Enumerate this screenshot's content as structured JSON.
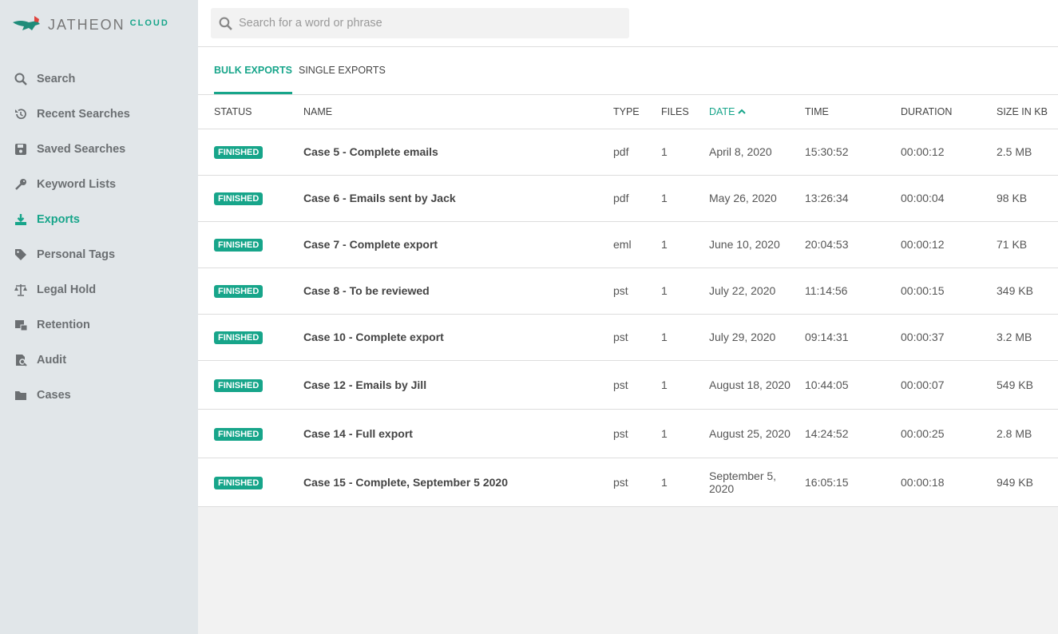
{
  "brand": {
    "name": "JATHEON",
    "suffix": "CLOUD",
    "colors": {
      "accent": "#17a58a",
      "sidebar": "#e1e6e9"
    }
  },
  "sidebar": {
    "items": [
      {
        "label": "Search",
        "icon": "search-icon"
      },
      {
        "label": "Recent Searches",
        "icon": "history-icon"
      },
      {
        "label": "Saved Searches",
        "icon": "save-icon"
      },
      {
        "label": "Keyword Lists",
        "icon": "key-icon"
      },
      {
        "label": "Exports",
        "icon": "download-icon",
        "active": true
      },
      {
        "label": "Personal Tags",
        "icon": "tag-icon"
      },
      {
        "label": "Legal Hold",
        "icon": "scale-icon"
      },
      {
        "label": "Retention",
        "icon": "retention-icon"
      },
      {
        "label": "Audit",
        "icon": "audit-icon"
      },
      {
        "label": "Cases",
        "icon": "folder-icon"
      }
    ]
  },
  "search": {
    "placeholder": "Search for a word or phrase",
    "value": ""
  },
  "tabs": [
    {
      "label": "BULK EXPORTS",
      "active": true
    },
    {
      "label": "SINGLE EXPORTS"
    }
  ],
  "table": {
    "columns": [
      "STATUS",
      "NAME",
      "TYPE",
      "FILES",
      "DATE",
      "TIME",
      "DURATION",
      "SIZE IN KB"
    ],
    "sort_column": "DATE",
    "sort_dir": "asc",
    "rows": [
      {
        "status": "FINISHED",
        "name": "Case 5 - Complete emails",
        "type": "pdf",
        "files": "1",
        "date": "April 8, 2020",
        "time": "15:30:52",
        "duration": "00:00:12",
        "size": "2.5 MB"
      },
      {
        "status": "FINISHED",
        "name": "Case 6 - Emails sent by Jack",
        "type": "pdf",
        "files": "1",
        "date": "May 26, 2020",
        "time": "13:26:34",
        "duration": "00:00:04",
        "size": "98 KB"
      },
      {
        "status": "FINISHED",
        "name": "Case 7 - Complete export",
        "type": "eml",
        "files": "1",
        "date": "June 10, 2020",
        "time": "20:04:53",
        "duration": "00:00:12",
        "size": "71 KB"
      },
      {
        "status": "FINISHED",
        "name": "Case 8 - To be reviewed",
        "type": "pst",
        "files": "1",
        "date": "July 22, 2020",
        "time": "11:14:56",
        "duration": "00:00:15",
        "size": "349 KB"
      },
      {
        "status": "FINISHED",
        "name": "Case 10 - Complete export",
        "type": "pst",
        "files": "1",
        "date": "July 29, 2020",
        "time": "09:14:31",
        "duration": "00:00:37",
        "size": "3.2 MB"
      },
      {
        "status": "FINISHED",
        "name": "Case 12 - Emails by Jill",
        "type": "pst",
        "files": "1",
        "date": "August 18, 2020",
        "time": "10:44:05",
        "duration": "00:00:07",
        "size": "549 KB"
      },
      {
        "status": "FINISHED",
        "name": "Case 14 - Full export",
        "type": "pst",
        "files": "1",
        "date": "August 25, 2020",
        "time": "14:24:52",
        "duration": "00:00:25",
        "size": "2.8 MB"
      },
      {
        "status": "FINISHED",
        "name": "Case 15 - Complete, September 5 2020",
        "type": "pst",
        "files": "1",
        "date": "September 5, 2020",
        "time": "16:05:15",
        "duration": "00:00:18",
        "size": "949 KB"
      }
    ]
  }
}
